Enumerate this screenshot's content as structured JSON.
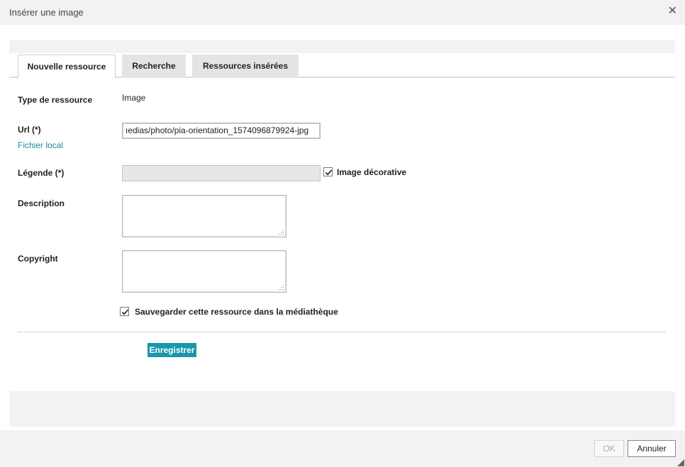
{
  "dialog": {
    "title": "Insérer une image",
    "close_icon": "close-icon"
  },
  "tabs": [
    {
      "label": "Nouvelle ressource",
      "active": true
    },
    {
      "label": "Recherche",
      "active": false
    },
    {
      "label": "Ressources insérées",
      "active": false
    }
  ],
  "form": {
    "type_label": "Type de ressource",
    "type_value": "Image",
    "url_label": "Url (*)",
    "url_value": "ıedias/photo/pia-orientation_1574096879924-jpg",
    "local_file_link": "Fichier local",
    "caption_label": "Légende (*)",
    "caption_value": "",
    "decorative_label": "Image décorative",
    "decorative_checked": true,
    "description_label": "Description",
    "description_value": "",
    "copyright_label": "Copyright",
    "copyright_value": "",
    "save_media_label": "Sauvegarder cette ressource dans la médiathèque",
    "save_media_checked": true,
    "save_button": "Enregistrer"
  },
  "footer": {
    "ok_label": "OK",
    "ok_enabled": false,
    "cancel_label": "Annuler"
  },
  "colors": {
    "accent": "#1a96ad",
    "link": "#1a8aa0",
    "background": "#f2f2f2"
  }
}
